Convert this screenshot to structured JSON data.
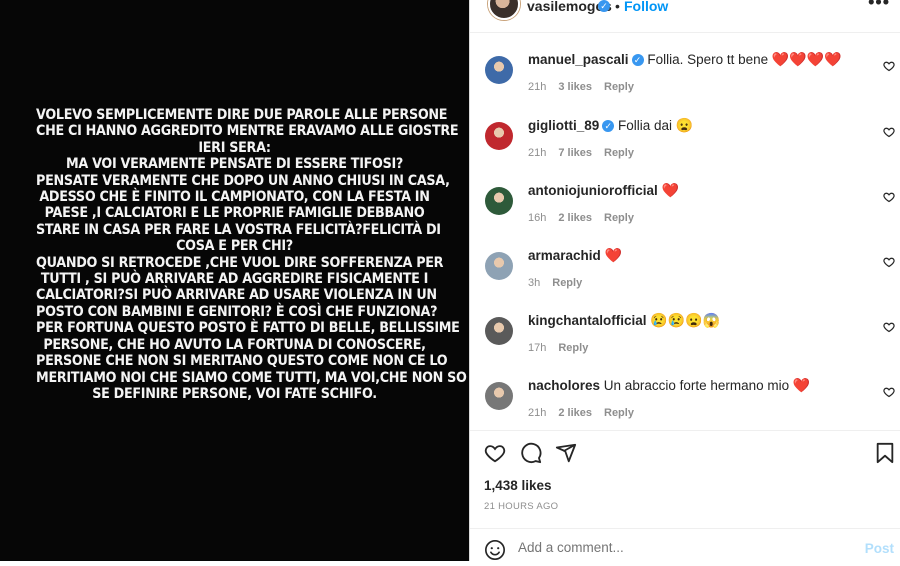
{
  "story": {
    "lines": [
      "VOLEVO SEMPLICEMENTE DIRE DUE PAROLE ALLE PERSONE",
      "CHE CI HANNO AGGREDITO MENTRE ERAVAMO ALLE GIOSTRE",
      "IERI SERA:",
      "MA VOI VERAMENTE PENSATE DI ESSERE TIFOSI?",
      "PENSATE VERAMENTE CHE DOPO UN ANNO CHIUSI IN CASA,",
      "ADESSO CHE È FINITO IL CAMPIONATO, CON LA FESTA IN",
      "PAESE ,I CALCIATORI E LE PROPRIE FAMIGLIE DEBBANO",
      "STARE IN CASA PER FARE LA VOSTRA FELICITÀ?FELICITÀ DI",
      "COSA E PER CHI?",
      "QUANDO SI RETROCEDE ,CHE VUOL DIRE SOFFERENZA PER",
      "TUTTI , SI PUÒ ARRIVARE AD AGGREDIRE FISICAMENTE I",
      "CALCIATORI?SI PUÒ ARRIVARE AD USARE VIOLENZA IN UN",
      "POSTO CON BAMBINI E GENITORI? È COSÌ CHE FUNZIONA?",
      "PER FORTUNA QUESTO POSTO È FATTO DI BELLE, BELLISSIME",
      "PERSONE, CHE HO AVUTO LA FORTUNA DI CONOSCERE,",
      "PERSONE CHE NON SI MERITANO QUESTO COME NON CE LO",
      "MERITIAMO NOI CHE SIAMO COME TUTTI, MA VOI,CHE NON SO",
      "SE DEFINIRE PERSONE, VOI FATE SCHIFO."
    ]
  },
  "header": {
    "username": "vasilemogos",
    "separator": "•",
    "follow_label": "Follow",
    "more_label": "•••"
  },
  "comments": [
    {
      "username": "manuel_pascali",
      "verified": true,
      "text": "Follia. Spero tt bene",
      "emoji": "❤️❤️❤️❤️",
      "time": "21h",
      "likes": "3 likes",
      "reply": "Reply",
      "avatar_color": "#3e6aa8"
    },
    {
      "username": "gigliotti_89",
      "verified": true,
      "text": "Follia dai",
      "emoji": "😦",
      "time": "21h",
      "likes": "7 likes",
      "reply": "Reply",
      "avatar_color": "#c0282e"
    },
    {
      "username": "antoniojuniorofficial",
      "verified": false,
      "text": "",
      "emoji": "❤️",
      "time": "16h",
      "likes": "2 likes",
      "reply": "Reply",
      "avatar_color": "#2e5a3a"
    },
    {
      "username": "armarachid",
      "verified": false,
      "text": "",
      "emoji": "❤️",
      "time": "3h",
      "likes": "",
      "reply": "Reply",
      "avatar_color": "#8ea2b4"
    },
    {
      "username": "kingchantalofficial",
      "verified": false,
      "text": "",
      "emoji": "😢😢😦😱",
      "time": "17h",
      "likes": "",
      "reply": "Reply",
      "avatar_color": "#5a5a5a"
    },
    {
      "username": "nacholores",
      "verified": false,
      "text": "Un abraccio forte hermano mio",
      "emoji": "❤️",
      "time": "21h",
      "likes": "2 likes",
      "reply": "Reply",
      "avatar_color": "#777777"
    }
  ],
  "post": {
    "likes": "1,438 likes",
    "time": "21 HOURS AGO"
  },
  "add_comment": {
    "placeholder": "Add a comment...",
    "post_label": "Post"
  },
  "colors": {
    "accent": "#0095f6",
    "heart": "#ed1c24",
    "muted": "#8e8e8e"
  }
}
